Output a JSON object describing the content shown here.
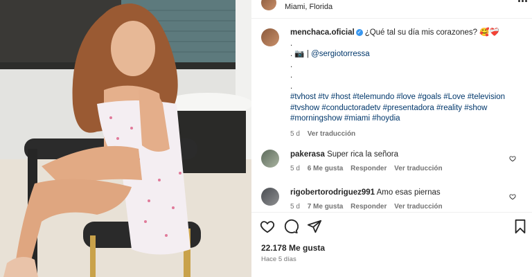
{
  "post": {
    "location_user_row": {
      "location": "Miami, Florida"
    },
    "author": "menchaca.oficial",
    "caption_text": "¿Qué tal su día mis corazones? 🥰❤️‍🩹",
    "caption_dot": ".",
    "credit_prefix": ". 📷 | ",
    "credit_tag": "@sergiotorressa",
    "hashtags_line1": "#tvhost #tv #host #telemundo #love #goals #Love #television",
    "hashtags_line2": "#tvshow #conductoradetv #presentadora #reality #show",
    "hashtags_line3": "#morningshow #miami #hoydia",
    "time": "5 d",
    "translate": "Ver traducción"
  },
  "comments": [
    {
      "user": "pakerasa",
      "text": "Super rica la señora",
      "time": "5 d",
      "likes": "6 Me gusta",
      "reply": "Responder",
      "translate": "Ver traducción"
    },
    {
      "user": "rigobertorodriguez991",
      "text": "Amo esas piernas",
      "time": "5 d",
      "likes": "7 Me gusta",
      "reply": "Responder",
      "translate": "Ver traducción"
    }
  ],
  "footer": {
    "likes": "22.178 Me gusta",
    "ago": "Hace 5 días"
  },
  "icons": [
    "more-icon",
    "heart-icon",
    "comment-icon",
    "share-icon",
    "bookmark-icon",
    "verified-icon",
    "heart-small-icon"
  ],
  "colors": {
    "hashtag": "#00376b",
    "meta": "#737373",
    "verified": "#3897f0"
  }
}
